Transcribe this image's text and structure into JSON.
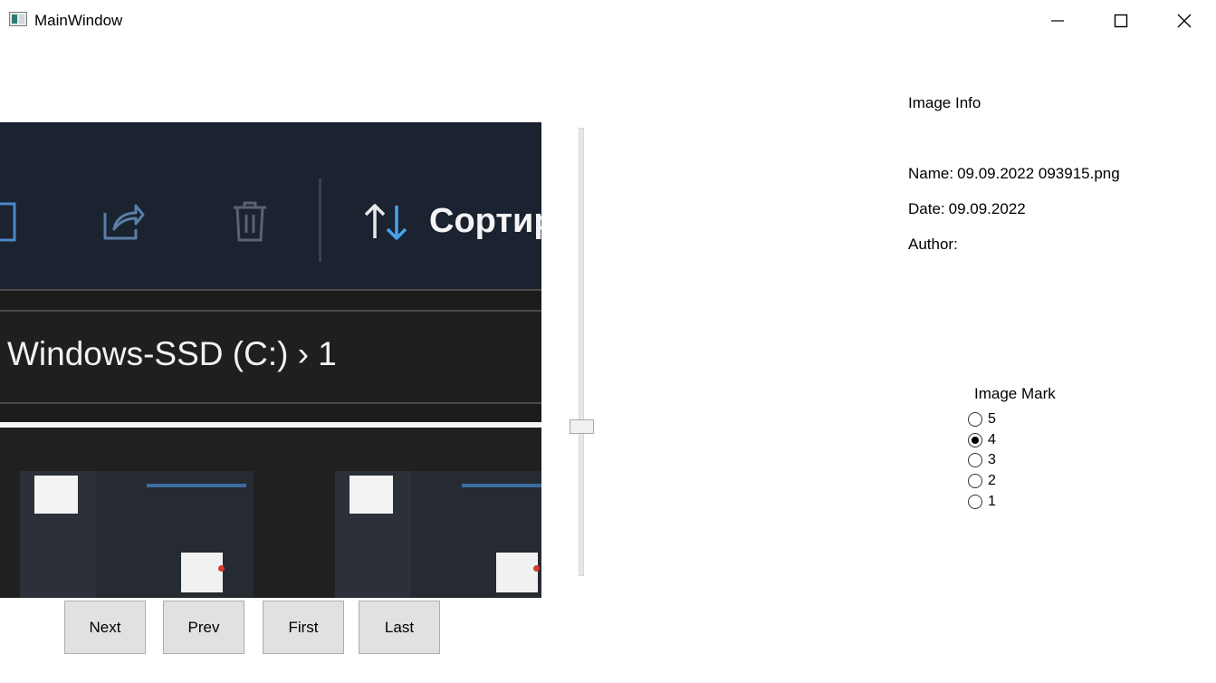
{
  "window": {
    "title": "MainWindow"
  },
  "viewer": {
    "path_text": "Windows-SSD (C:)  ›  1",
    "sort_text": "Сортиро"
  },
  "nav": {
    "next": "Next",
    "prev": "Prev",
    "first": "First",
    "last": "Last"
  },
  "info": {
    "heading": "Image Info",
    "name_label": "Name:",
    "name_value": "09.09.2022 093915.png",
    "date_label": "Date:",
    "date_value": "09.09.2022",
    "author_label": "Author:",
    "author_value": ""
  },
  "mark": {
    "title": "Image Mark",
    "options": [
      "5",
      "4",
      "3",
      "2",
      "1"
    ],
    "selected": "4"
  }
}
